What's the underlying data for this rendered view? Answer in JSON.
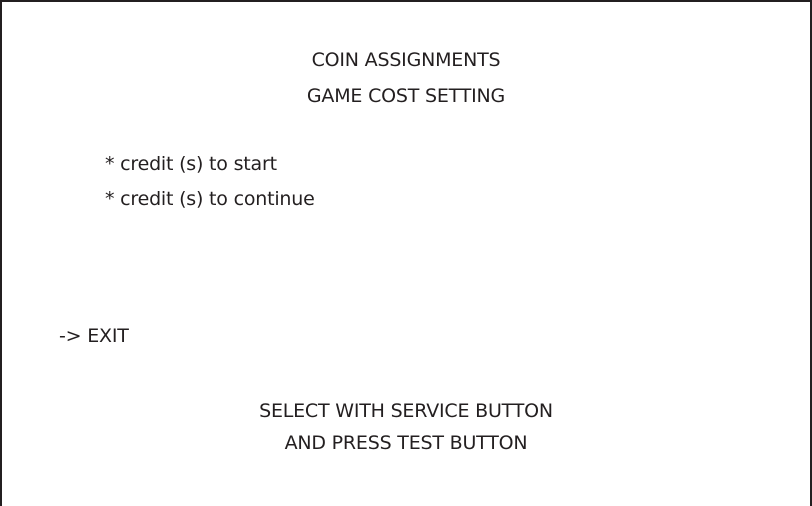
{
  "menu": {
    "title_line1": "COIN ASSIGNMENTS",
    "title_line2": "GAME COST SETTING",
    "items": [
      {
        "label": "* credit (s) to start"
      },
      {
        "label": "* credit (s) to continue"
      }
    ],
    "exit_cursor": "->",
    "exit_label": "EXIT",
    "instructions_line1": "SELECT WITH SERVICE BUTTON",
    "instructions_line2": "AND PRESS TEST BUTTON"
  },
  "colors": {
    "text": "#231f20",
    "background": "#ffffff",
    "frame": "#231f20"
  }
}
